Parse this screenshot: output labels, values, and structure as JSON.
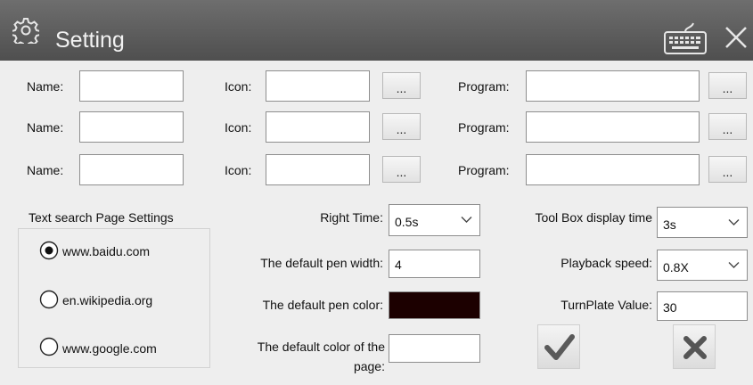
{
  "window": {
    "title": "Setting"
  },
  "icons": {
    "settings": "gear-icon",
    "keyboard": "keyboard-icon",
    "close": "close-icon"
  },
  "rows": [
    {
      "name_label": "Name:",
      "name_value": "",
      "icon_label": "Icon:",
      "icon_value": "",
      "icon_browse": "...",
      "program_label": "Program:",
      "program_value": "",
      "program_browse": "..."
    },
    {
      "name_label": "Name:",
      "name_value": "",
      "icon_label": "Icon:",
      "icon_value": "",
      "icon_browse": "...",
      "program_label": "Program:",
      "program_value": "",
      "program_browse": "..."
    },
    {
      "name_label": "Name:",
      "name_value": "",
      "icon_label": "Icon:",
      "icon_value": "",
      "icon_browse": "...",
      "program_label": "Program:",
      "program_value": "",
      "program_browse": "..."
    }
  ],
  "search": {
    "title": "Text search Page Settings",
    "options": [
      {
        "label": "www.baidu.com",
        "selected": true
      },
      {
        "label": "en.wikipedia.org",
        "selected": false
      },
      {
        "label": "www.google.com",
        "selected": false
      }
    ]
  },
  "middle": {
    "right_time_label": "Right Time:",
    "right_time_value": "0.5s",
    "pen_width_label": "The default pen width:",
    "pen_width_value": "4",
    "pen_color_label": "The default pen color:",
    "pen_color_value": "#1c0000",
    "page_color_label_1": "The default color of the",
    "page_color_label_2": "page:",
    "page_color_value": "#ffffff"
  },
  "right": {
    "toolbox_label": "Tool Box display time",
    "toolbox_value": "3s",
    "playback_label": "Playback speed:",
    "playback_value": "0.8X",
    "turnplate_label": "TurnPlate Value:",
    "turnplate_value": "30"
  },
  "actions": {
    "ok_icon": "check-icon",
    "cancel_icon": "x-icon"
  }
}
